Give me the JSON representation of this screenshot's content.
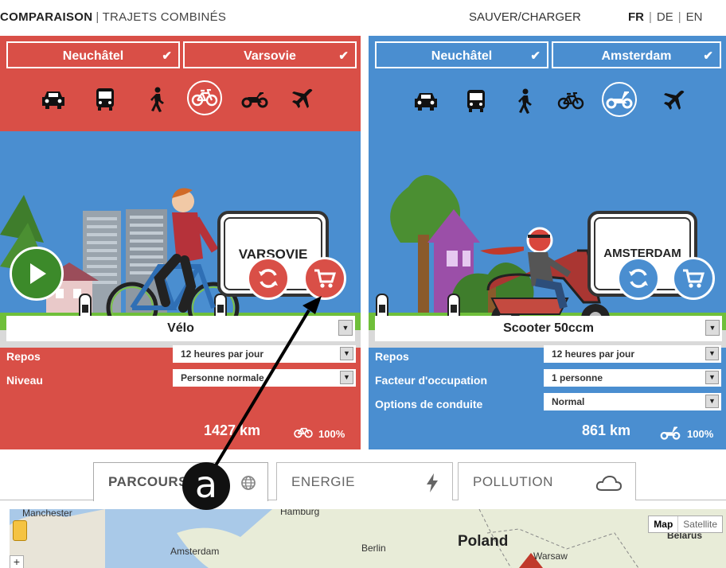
{
  "nav": {
    "active_tab": "COMPARAISON",
    "separator": "|",
    "other_tab": "TRAJETS COMBINÉS",
    "save_load": "SAUVER/CHARGER",
    "languages": [
      "FR",
      "DE",
      "EN"
    ],
    "current_language": "FR"
  },
  "left": {
    "from": "Neuchâtel",
    "to": "Varsovie",
    "sign": "VARSOVIE",
    "modes": [
      "car-icon",
      "bus-icon",
      "walk-icon",
      "bicycle-icon",
      "motorbike-icon",
      "plane-icon"
    ],
    "selected_mode": "bicycle-icon",
    "vehicle": "Vélo",
    "rows": [
      {
        "label": "Repos",
        "value": "12 heures par jour"
      },
      {
        "label": "Niveau",
        "value": "Personne normale"
      }
    ],
    "distance": "1427 km",
    "percent": "100%",
    "color": "#d94f47"
  },
  "right": {
    "from": "Neuchâtel",
    "to": "Amsterdam",
    "sign": "AMSTERDAM",
    "modes": [
      "car-icon",
      "bus-icon",
      "walk-icon",
      "bicycle-icon",
      "scooter-icon",
      "plane-icon"
    ],
    "selected_mode": "scooter-icon",
    "vehicle": "Scooter 50ccm",
    "rows": [
      {
        "label": "Repos",
        "value": "12 heures par jour"
      },
      {
        "label": "Facteur d'occupation",
        "value": "1 personne"
      },
      {
        "label": "Options de conduite",
        "value": "Normal"
      }
    ],
    "distance": "861 km",
    "percent": "100%",
    "color": "#4a8ed0"
  },
  "tabs": [
    {
      "label": "PARCOURS",
      "icon": "globe-icon"
    },
    {
      "label": "ENERGIE",
      "icon": "lightning-icon"
    },
    {
      "label": "POLLUTION",
      "icon": "cloud-icon"
    }
  ],
  "map": {
    "labels": [
      "Manchester",
      "Hamburg",
      "Amsterdam",
      "Berlin",
      "Poland",
      "Warsaw",
      "Belarus"
    ],
    "map_type": [
      "Map",
      "Satellite"
    ]
  },
  "annotation": "a"
}
